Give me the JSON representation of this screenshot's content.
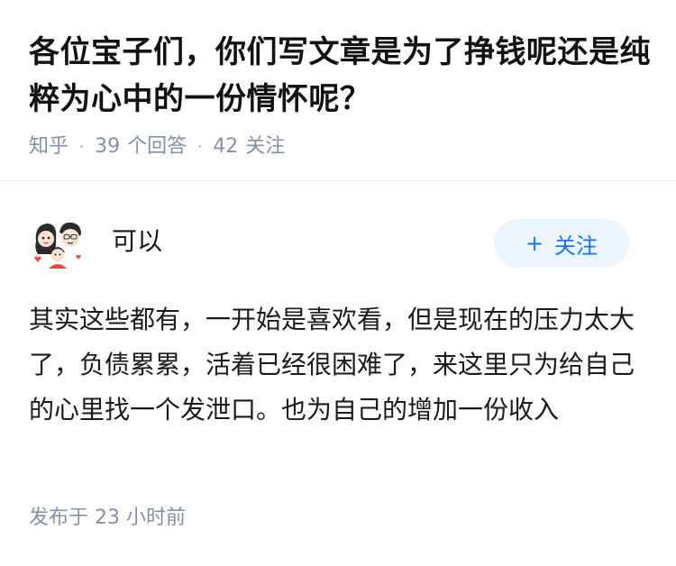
{
  "question": {
    "title": "各位宝子们，你们写文章是为了挣钱呢还是纯粹为心中的一份情怀呢？",
    "source": "知乎",
    "answer_count": "39",
    "answer_label": "个回答",
    "follower_count": "42",
    "follower_label": "关注"
  },
  "answer": {
    "author_name": "可以",
    "avatar_icon": "cartoon-family-avatar",
    "follow_button_label": "关注",
    "follow_button_icon": "+",
    "content": "其实这些都有，一开始是喜欢看，但是现在的压力太大了，负债累累，活着已经很困难了，来这里只为给自己的心里找一个发泄口。也为自己的增加一份收入",
    "published_prefix": "发布于",
    "published_time": "23 小时前"
  },
  "colors": {
    "meta_gray": "#8590a6",
    "accent_blue": "#1772f6",
    "follow_bg": "#ebf5ff",
    "text_dark": "#1a1a1a"
  }
}
